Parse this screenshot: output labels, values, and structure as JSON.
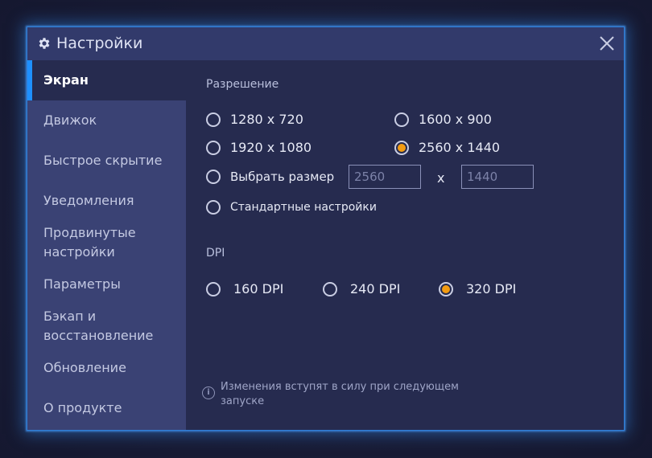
{
  "window": {
    "title": "Настройки",
    "close_icon": "close-icon",
    "gear_icon": "gear-icon"
  },
  "sidebar": {
    "items": [
      {
        "label": "Экран",
        "active": true
      },
      {
        "label": "Движок",
        "active": false
      },
      {
        "label": "Быстрое скрытие",
        "active": false
      },
      {
        "label": "Уведомления",
        "active": false
      },
      {
        "label": "Продвинутые настройки",
        "active": false
      },
      {
        "label": "Параметры",
        "active": false
      },
      {
        "label": "Бэкап и восстановление",
        "active": false
      },
      {
        "label": "Обновление",
        "active": false
      },
      {
        "label": "О продукте",
        "active": false
      }
    ]
  },
  "resolution": {
    "title": "Разрешение",
    "options": [
      {
        "label": "1280 x 720",
        "checked": false
      },
      {
        "label": "1600 x 900",
        "checked": false
      },
      {
        "label": "1920 x 1080",
        "checked": false
      },
      {
        "label": "2560 x 1440",
        "checked": true
      }
    ],
    "custom": {
      "label": "Выбрать размер",
      "checked": false,
      "width_placeholder": "2560",
      "height_placeholder": "1440",
      "separator": "x"
    },
    "default": {
      "label": "Стандартные настройки",
      "checked": false
    }
  },
  "dpi": {
    "title": "DPI",
    "options": [
      {
        "label": "160 DPI",
        "checked": false
      },
      {
        "label": "240 DPI",
        "checked": false
      },
      {
        "label": "320 DPI",
        "checked": true
      }
    ]
  },
  "notice": {
    "text": "Изменения вступят в силу при следующем запуске",
    "icon": "info-icon",
    "icon_glyph": "i"
  },
  "colors": {
    "accent": "#1e90ff",
    "radio_checked": "#f39c12",
    "border_glow": "#2f7fd8"
  }
}
